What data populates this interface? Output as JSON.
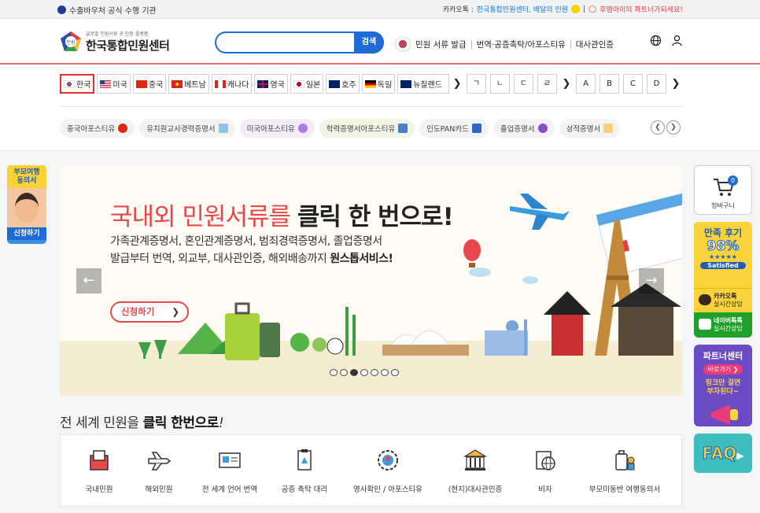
{
  "topbar": {
    "left_text": "수출바우처 공식 수행 기관",
    "kakao_label": "카카오톡 :",
    "kakao_link": "한국통합민원센터, 배달의 민원",
    "partner_text": "후엠아이의 파트너가되세요!"
  },
  "header": {
    "logo_small": "글로벌 민원서류 공·인증 플랫폼",
    "logo_title": "한국통합민원센터",
    "logo_badge": "민원",
    "search_placeholder": "",
    "search_button": "검색",
    "nav": [
      "민원 서류 발급",
      "번역·공증촉탁/아포스티유",
      "대사관인증"
    ]
  },
  "countries": [
    {
      "label": "한국",
      "flag": "kr",
      "active": true
    },
    {
      "label": "미국",
      "flag": "us"
    },
    {
      "label": "중국",
      "flag": "cn"
    },
    {
      "label": "베트남",
      "flag": "vn"
    },
    {
      "label": "캐나다",
      "flag": "ca"
    },
    {
      "label": "영국",
      "flag": "gb"
    },
    {
      "label": "일본",
      "flag": "jp"
    },
    {
      "label": "호주",
      "flag": "au"
    },
    {
      "label": "독일",
      "flag": "de"
    },
    {
      "label": "뉴질랜드",
      "flag": "nz"
    }
  ],
  "letters": [
    "ㄱ",
    "ㄴ",
    "ㄷ",
    "ㄹ",
    "A",
    "B",
    "C",
    "D"
  ],
  "chips": [
    "중국아포스티유",
    "유치원교사경력증명서",
    "미국아포스티유",
    "학력증명서아포스티유",
    "인도PAN카드",
    "졸업증명서",
    "성적증명서"
  ],
  "side_left": {
    "title_line1": "부모여행",
    "title_line2": "동의서",
    "button": "신청하기"
  },
  "banner": {
    "title_red": "국내외 민원서류를 ",
    "title_bold": "클릭 한 번으로!",
    "sub1": "가족관계증명서, 혼인관계증명서, 범죄경력증명서, 졸업증명서",
    "sub2": "발급부터 번역, 외교부, 대사관인증, 해외배송까지 ",
    "sub2_bold": "원스톱서비스!",
    "cta": "신청하기",
    "dots_total": 7,
    "dots_active": 3
  },
  "right": {
    "cart_label": "장바구니",
    "cart_count": "0",
    "review_title": "만족 후기",
    "review_pct": "98%",
    "review_sat": "Satisfied",
    "kakao_line1": "카카오톡",
    "kakao_line2": "실시간상담",
    "naver_line1": "네이버톡톡",
    "naver_line2": "실시간상담",
    "partner_title": "파트너센터",
    "partner_btn": "바로가기",
    "partner_line1": "링크만 걸면",
    "partner_line2": "부자된다~",
    "faq": "FAQ"
  },
  "section": {
    "title_plain": "전 세계 민원을 ",
    "title_bold": "클릭 한번으로",
    "title_end": "!"
  },
  "services": [
    "국내민원",
    "해외민원",
    "전 세계 언어 번역",
    "공증 촉탁 대리",
    "영사확인 / 아포스티유",
    "(현지)대사관인증",
    "비자",
    "부모미동반 여행동의서"
  ]
}
